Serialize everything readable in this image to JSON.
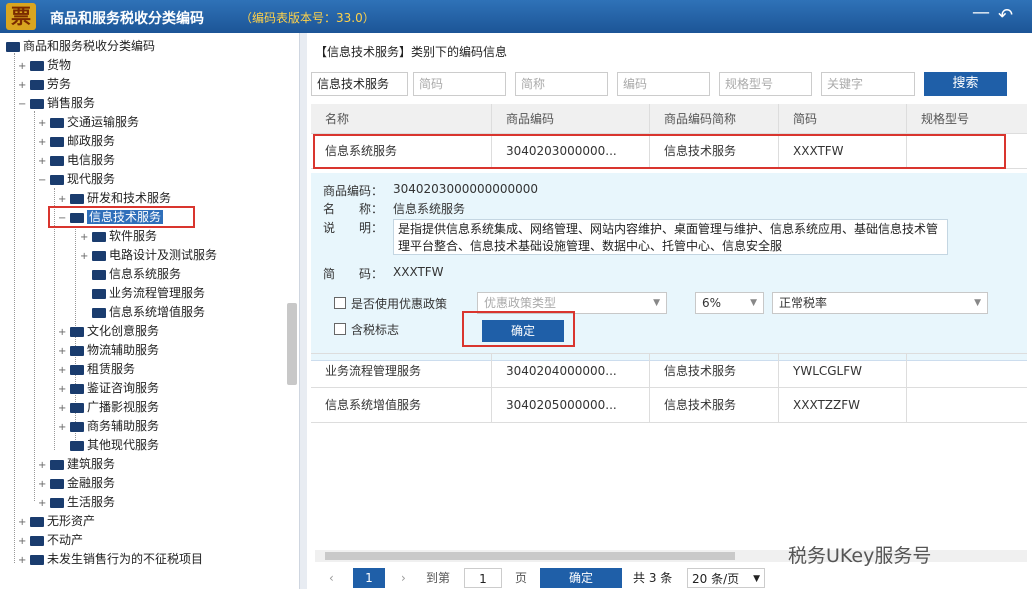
{
  "titlebar": {
    "logo": "票",
    "title": "商品和服务税收分类编码",
    "version": "（编码表版本号：33.0）",
    "minimize_icon": "minimize-icon",
    "back_icon": "back-icon"
  },
  "tree": {
    "root": "商品和服务税收分类编码",
    "items": [
      {
        "label": "货物"
      },
      {
        "label": "劳务"
      },
      {
        "label": "销售服务"
      },
      {
        "label": "交通运输服务"
      },
      {
        "label": "邮政服务"
      },
      {
        "label": "电信服务"
      },
      {
        "label": "现代服务"
      },
      {
        "label": "研发和技术服务"
      },
      {
        "label": "信息技术服务"
      },
      {
        "label": "软件服务"
      },
      {
        "label": "电路设计及测试服务"
      },
      {
        "label": "信息系统服务"
      },
      {
        "label": "业务流程管理服务"
      },
      {
        "label": "信息系统增值服务"
      },
      {
        "label": "文化创意服务"
      },
      {
        "label": "物流辅助服务"
      },
      {
        "label": "租赁服务"
      },
      {
        "label": "鉴证咨询服务"
      },
      {
        "label": "广播影视服务"
      },
      {
        "label": "商务辅助服务"
      },
      {
        "label": "其他现代服务"
      },
      {
        "label": "建筑服务"
      },
      {
        "label": "金融服务"
      },
      {
        "label": "生活服务"
      },
      {
        "label": "无形资产"
      },
      {
        "label": "不动产"
      },
      {
        "label": "未发生销售行为的不征税项目"
      }
    ]
  },
  "main": {
    "heading": "【信息技术服务】类别下的编码信息",
    "search": {
      "category_value": "信息技术服务",
      "jianma_placeholder": "简码",
      "name_placeholder": "简称",
      "code_placeholder": "编码",
      "spec_placeholder": "规格型号",
      "keyword_placeholder": "关键字",
      "button": "搜索"
    },
    "columns": [
      "名称",
      "商品编码",
      "商品编码简称",
      "简码",
      "规格型号"
    ],
    "rows": [
      [
        "信息系统服务",
        "3040203000000...",
        "信息技术服务",
        "XXXTFW",
        ""
      ],
      [
        "业务流程管理服务",
        "3040204000000...",
        "信息技术服务",
        "YWLCGLFW",
        ""
      ],
      [
        "信息系统增值服务",
        "3040205000000...",
        "信息技术服务",
        "XXXTZZFW",
        ""
      ]
    ],
    "detail": {
      "code_label": "商品编码：",
      "code_value": "3040203000000000000",
      "name_label": "名　　称：",
      "name_value": "信息系统服务",
      "desc_label": "说　　明：",
      "desc_value": "是指提供信息系统集成、网络管理、网站内容维护、桌面管理与维护、信息系统应用、基础信息技术管理平台整合、信息技术基础设施管理、数据中心、托管中心、信息安全服",
      "jianma_label": "简　　码：",
      "jianma_value": "XXXTFW",
      "policy_label": "是否使用优惠政策",
      "policy_type_placeholder": "优惠政策类型",
      "rate_value": "6%",
      "rate_type_value": "正常税率",
      "tax_included_label": "含税标志",
      "confirm_button": "确定"
    },
    "pager": {
      "current_page": "1",
      "goto_label": "到第",
      "goto_value": "1",
      "page_suffix": "页",
      "confirm": "确定",
      "total": "共 3 条",
      "page_size": "20 条/页"
    }
  },
  "watermark": "税务UKey服务号"
}
